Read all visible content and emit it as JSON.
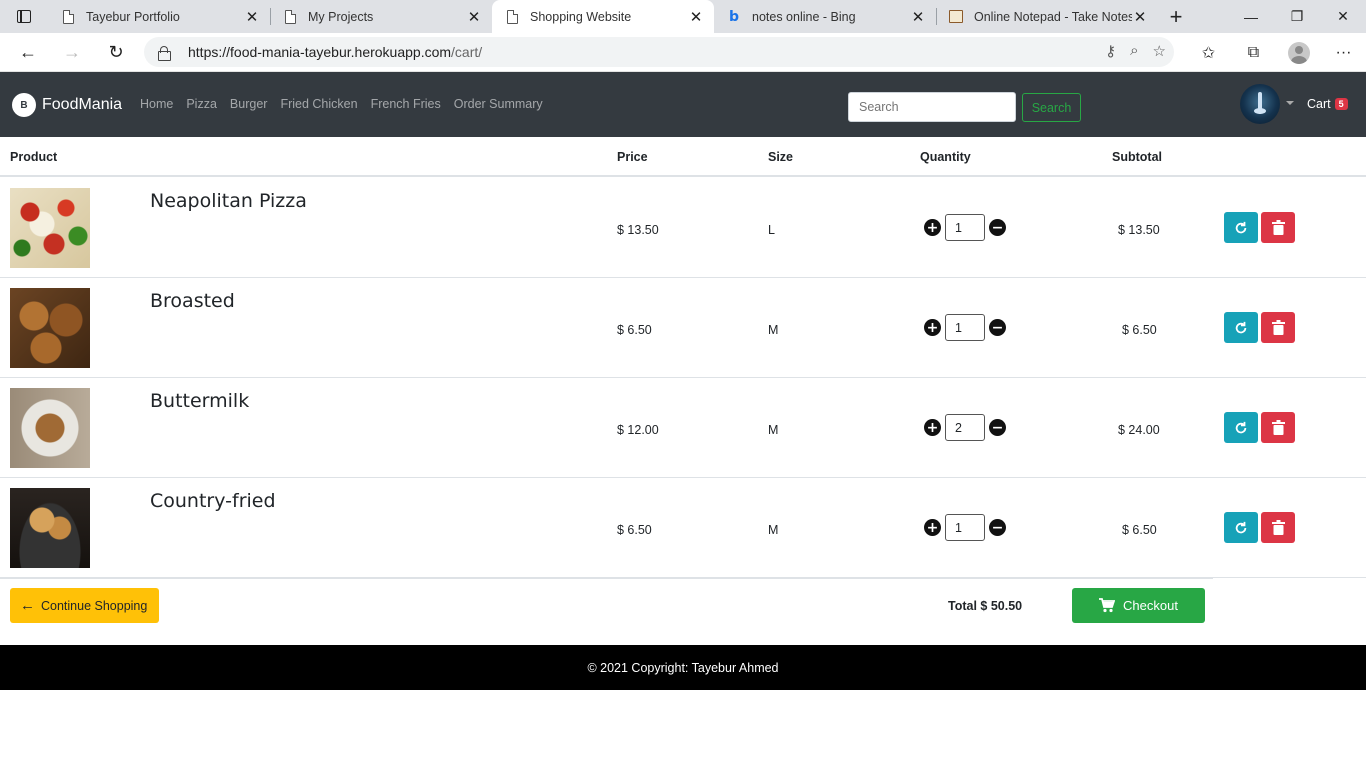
{
  "browser": {
    "tabs": [
      {
        "title": "Tayebur Portfolio",
        "icon": "page-icon",
        "active": false
      },
      {
        "title": "My Projects",
        "icon": "page-icon",
        "active": false
      },
      {
        "title": "Shopping Website",
        "icon": "page-icon",
        "active": true
      },
      {
        "title": "notes online - Bing",
        "icon": "bing-icon",
        "active": false
      },
      {
        "title": "Online Notepad - Take Notes",
        "icon": "notepad-icon",
        "active": false
      }
    ],
    "url_host": "https://food-mania-tayebur.herokuapp.com",
    "url_path": "/cart/"
  },
  "navbar": {
    "brand": "FoodMania",
    "links": [
      "Home",
      "Pizza",
      "Burger",
      "Fried Chicken",
      "French Fries",
      "Order Summary"
    ],
    "search_placeholder": "Search",
    "search_button": "Search",
    "cart_label": "Cart",
    "cart_count": "5"
  },
  "table": {
    "headers": {
      "product": "Product",
      "price": "Price",
      "size": "Size",
      "quantity": "Quantity",
      "subtotal": "Subtotal"
    },
    "rows": [
      {
        "name": "Neapolitan Pizza",
        "price": "$ 13.50",
        "size": "L",
        "qty": "1",
        "subtotal": "$ 13.50"
      },
      {
        "name": "Broasted",
        "price": "$ 6.50",
        "size": "M",
        "qty": "1",
        "subtotal": "$ 6.50"
      },
      {
        "name": "Buttermilk",
        "price": "$ 12.00",
        "size": "M",
        "qty": "2",
        "subtotal": "$ 24.00"
      },
      {
        "name": "Country-fried",
        "price": "$ 6.50",
        "size": "M",
        "qty": "1",
        "subtotal": "$ 6.50"
      }
    ]
  },
  "summary": {
    "continue_label": "Continue Shopping",
    "total_label": "Total $ 50.50",
    "checkout_label": "Checkout"
  },
  "footer": {
    "copyright": "© 2021 Copyright: Tayebur Ahmed"
  },
  "colors": {
    "navbar_bg": "#343a40",
    "update_btn": "#17a2b8",
    "remove_btn": "#dc3545",
    "continue_btn": "#ffc107",
    "checkout_btn": "#28a745"
  }
}
